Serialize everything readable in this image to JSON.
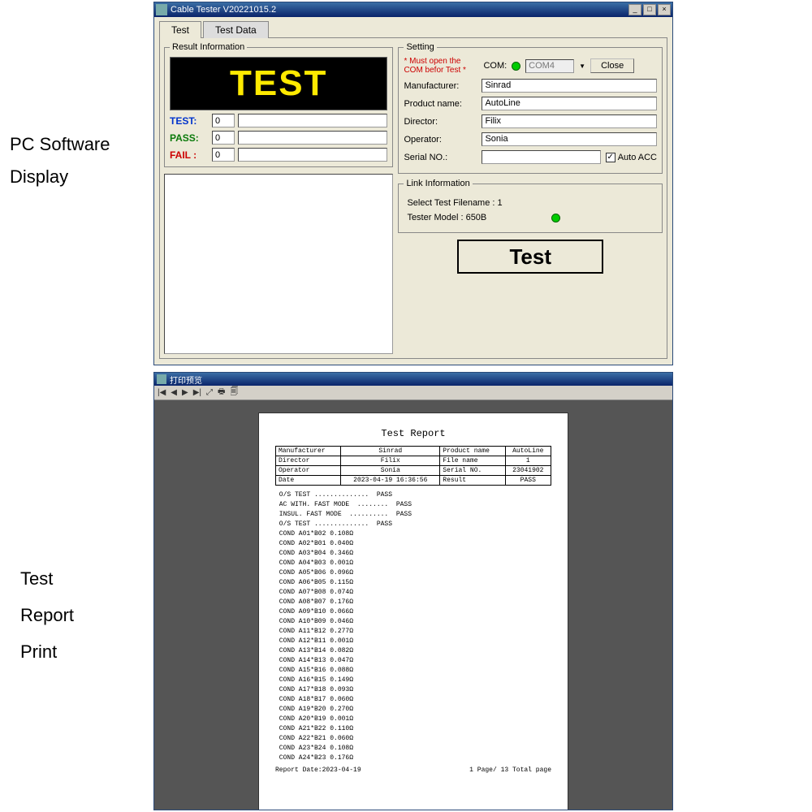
{
  "captions": {
    "top1": "PC Software",
    "top2": "Display",
    "bot1": "Test",
    "bot2": "Report",
    "bot3": "Print"
  },
  "app": {
    "title": "Cable Tester V20221015.2",
    "tabs": {
      "test": "Test",
      "testdata": "Test Data"
    },
    "result_legend": "Result Information",
    "test_display": "TEST",
    "stats": {
      "test_label": "TEST:",
      "test_val": "0",
      "pass_label": "PASS:",
      "pass_val": "0",
      "fail_label": "FAIL :",
      "fail_val": "0"
    },
    "setting_legend": "Setting",
    "setting": {
      "warn": "* Must open the COM befor Test *",
      "com_label": "COM:",
      "com_value": "COM4",
      "close_btn": "Close",
      "manufacturer_label": "Manufacturer:",
      "manufacturer": "Sinrad",
      "product_label": "Product name:",
      "product": "AutoLine",
      "director_label": "Director:",
      "director": "Filix",
      "operator_label": "Operator:",
      "operator": "Sonia",
      "serial_label": "Serial NO.:",
      "serial": "",
      "autoacc_label": "Auto ACC"
    },
    "link_legend": "Link Information",
    "link": {
      "filename": "Select Test Filename : 1",
      "model": "Tester Model : 650B"
    },
    "test_btn": "Test"
  },
  "preview": {
    "title": "打印预览",
    "toolbar": [
      "|◀",
      "◀",
      "▶",
      "▶|",
      "⤢",
      "🖶",
      "🗐"
    ],
    "report_title": "Test Report",
    "table": {
      "manufacturer_l": "Manufacturer",
      "manufacturer_v": "Sinrad",
      "product_l": "Product name",
      "product_v": "AutoLine",
      "director_l": "Director",
      "director_v": "Filix",
      "filename_l": "File name",
      "filename_v": "1",
      "operator_l": "Operator",
      "operator_v": "Sonia",
      "serial_l": "Serial NO.",
      "serial_v": "23041902",
      "date_l": "Date",
      "date_v": "2023-04-19 16:36:56",
      "result_l": "Result",
      "result_v": "PASS"
    },
    "lines": [
      "O/S TEST ..............  PASS",
      "AC WITH. FAST MODE  ........  PASS",
      "INSUL. FAST MODE  ..........  PASS",
      "O/S TEST ..............  PASS",
      "COND A01*B02 0.108Ω",
      "COND A02*B01 0.040Ω",
      "COND A03*B04 0.346Ω",
      "COND A04*B03 0.001Ω",
      "COND A05*B06 0.096Ω",
      "COND A06*B05 0.115Ω",
      "COND A07*B08 0.074Ω",
      "COND A08*B07 0.176Ω",
      "COND A09*B10 0.066Ω",
      "COND A10*B09 0.046Ω",
      "COND A11*B12 0.277Ω",
      "COND A12*B11 0.001Ω",
      "COND A13*B14 0.082Ω",
      "COND A14*B13 0.047Ω",
      "COND A15*B16 0.088Ω",
      "COND A16*B15 0.149Ω",
      "COND A17*B18 0.093Ω",
      "COND A18*B17 0.060Ω",
      "COND A19*B20 0.270Ω",
      "COND A20*B19 0.001Ω",
      "COND A21*B22 0.110Ω",
      "COND A22*B21 0.060Ω",
      "COND A23*B24 0.108Ω",
      "COND A24*B23 0.176Ω"
    ],
    "footer_left": "Report Date:2023-04-19",
    "footer_right": "1 Page/ 13 Total page"
  }
}
